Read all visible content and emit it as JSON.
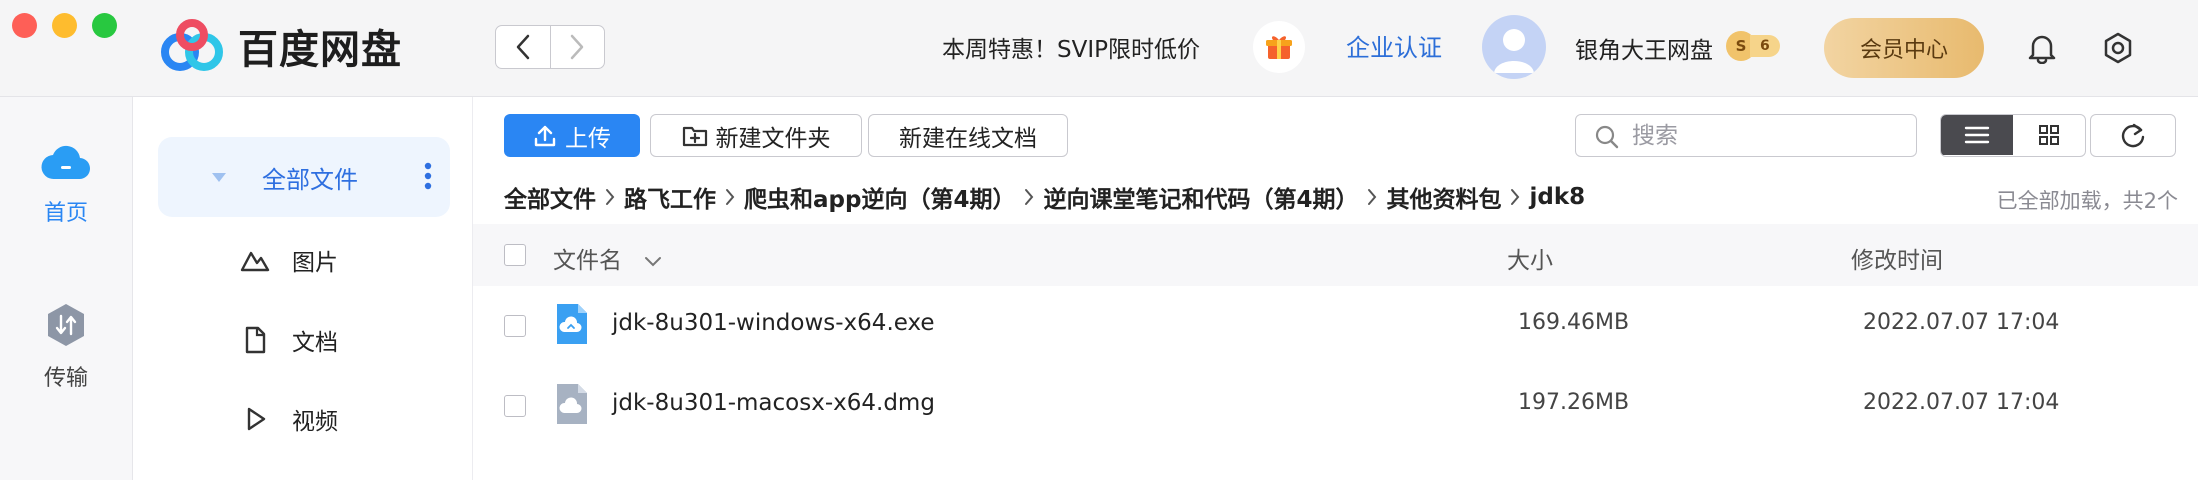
{
  "app": {
    "name": "百度网盘"
  },
  "header": {
    "promo_text": "本周特惠！SVIP限时低价",
    "enterprise_link": "企业认证",
    "username": "银角大王网盘",
    "vip_badge": "S",
    "vip_level": "6",
    "member_button": "会员中心"
  },
  "rail": {
    "items": [
      {
        "label": "首页",
        "icon": "cloud-icon",
        "active": true
      },
      {
        "label": "传输",
        "icon": "transfer-icon",
        "active": false
      }
    ]
  },
  "sidebar": {
    "all_files": "全部文件",
    "items": [
      {
        "label": "图片",
        "icon": "image-icon"
      },
      {
        "label": "文档",
        "icon": "document-icon"
      },
      {
        "label": "视频",
        "icon": "video-icon"
      }
    ]
  },
  "toolbar": {
    "upload": "上传",
    "new_folder": "新建文件夹",
    "new_online_doc": "新建在线文档",
    "search_placeholder": "搜索"
  },
  "breadcrumb": [
    "全部文件",
    "路飞工作",
    "爬虫和app逆向（第4期）",
    "逆向课堂笔记和代码（第4期）",
    "其他资料包",
    "jdk8"
  ],
  "status": {
    "loaded_text": "已全部加载，共2个"
  },
  "table": {
    "headers": {
      "name": "文件名",
      "size": "大小",
      "modified": "修改时间"
    },
    "rows": [
      {
        "name": "jdk-8u301-windows-x64.exe",
        "size": "169.46MB",
        "modified": "2022.07.07 17:04",
        "icon": "exe-file-icon"
      },
      {
        "name": "jdk-8u301-macosx-x64.dmg",
        "size": "197.26MB",
        "modified": "2022.07.07 17:04",
        "icon": "dmg-file-icon"
      }
    ]
  },
  "colors": {
    "accent": "#2a86f3",
    "link": "#2c6ed8",
    "active_bg": "#eef5fe",
    "member_gold": "#e8ba6e"
  }
}
